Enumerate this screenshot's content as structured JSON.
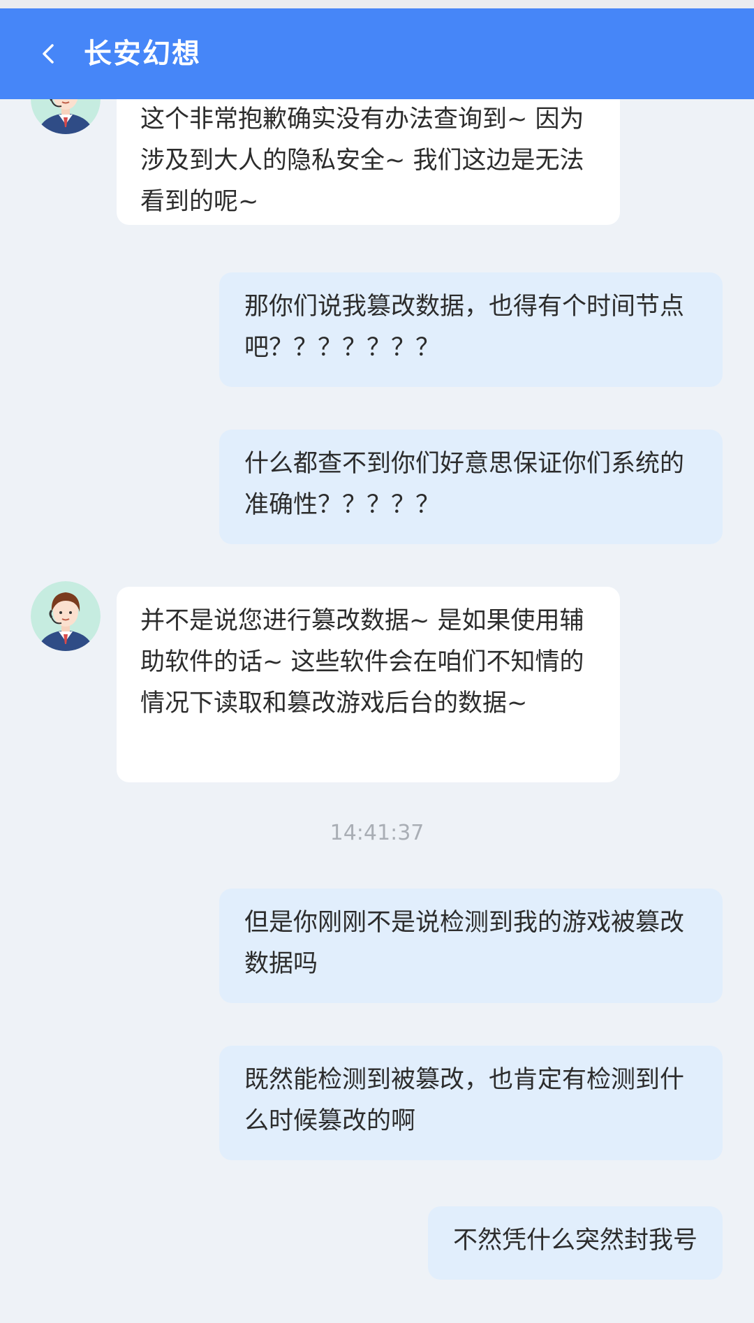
{
  "header": {
    "title": "长安幻想",
    "back_icon": "chevron-left-icon"
  },
  "colors": {
    "header_bg": "#4686f8",
    "page_bg": "#eef2f7",
    "agent_bubble": "#ffffff",
    "user_bubble": "#e1eefc",
    "timestamp_text": "#a9aeb5"
  },
  "messages": [
    {
      "sender": "agent",
      "text": "这个非常抱歉确实没有办法查询到~ 因为涉及到大人的隐私安全~ 我们这边是无法看到的呢~"
    },
    {
      "sender": "user",
      "text": "那你们说我篡改数据，也得有个时间节点吧？？？？？？？"
    },
    {
      "sender": "user",
      "text": "什么都查不到你们好意思保证你们系统的准确性？？？？？"
    },
    {
      "sender": "agent",
      "text": "并不是说您进行篡改数据~ 是如果使用辅助软件的话~ 这些软件会在咱们不知情的情况下读取和篡改游戏后台的数据~"
    },
    {
      "sender": "user",
      "text": "但是你刚刚不是说检测到我的游戏被篡改数据吗"
    },
    {
      "sender": "user",
      "text": "既然能检测到被篡改，也肯定有检测到什么时候篡改的啊"
    },
    {
      "sender": "user",
      "text": "不然凭什么突然封我号"
    }
  ],
  "timestamp": "14:41:37",
  "avatar_icon": "customer-service-agent-avatar-icon"
}
